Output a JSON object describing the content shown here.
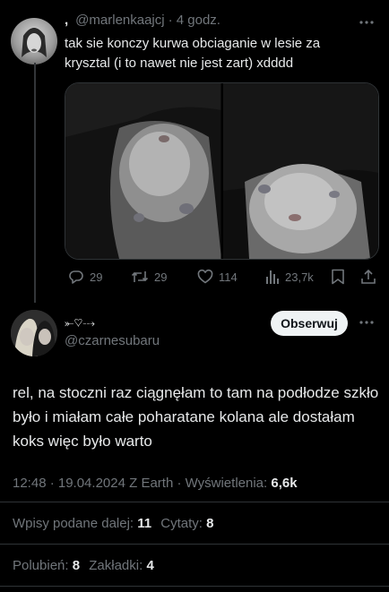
{
  "tweet1": {
    "display_name": ",",
    "handle": "@marlenkaajcj",
    "time": "· 4 godz.",
    "text": "tak sie konczy kurwa obciaganie w lesie za krysztal (i to nawet nie jest zart) xdddd",
    "stats": {
      "replies": "29",
      "retweets": "29",
      "likes": "114",
      "views": "23,7k"
    },
    "icons": [
      "more-icon",
      "reply-icon",
      "retweet-icon",
      "like-icon",
      "views-icon",
      "bookmark-icon",
      "share-icon"
    ]
  },
  "tweet2": {
    "display_name": "⤜♡⤏",
    "handle": "@czarnesubaru",
    "follow_label": "Obserwuj",
    "text": "rel, na stoczni raz ciągnęłam to tam na podłodze szkło było i miałam całe poharatane kolana ale dostałam koks więc było warto",
    "meta_prefix": "12:48 · 19.04.2024 Z Earth · Wyświetlenia:",
    "meta_views": "6,6k",
    "retweets_label": "Wpisy podane dalej:",
    "retweets_value": "11",
    "quotes_label": "Cytaty:",
    "quotes_value": "8",
    "likes_label": "Polubień:",
    "likes_value": "8",
    "bookmarks_label": "Zakładki:",
    "bookmarks_value": "4"
  },
  "colors": {
    "background": "#000000",
    "text": "#e7e9ea",
    "muted": "#71767b",
    "divider": "#2f3336",
    "button": "#eff3f4"
  }
}
